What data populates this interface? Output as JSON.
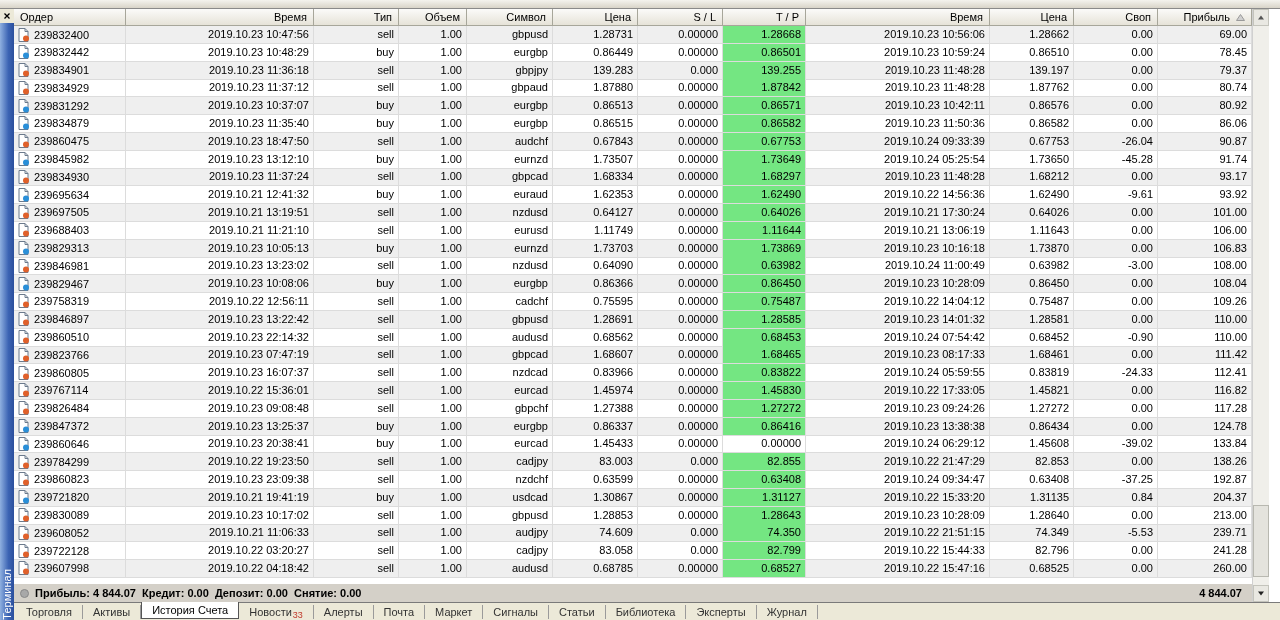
{
  "sidebar": {
    "title": "Терминал"
  },
  "columns": [
    {
      "label": "Ордер",
      "sorted": false
    },
    {
      "label": "Время",
      "sorted": false
    },
    {
      "label": "Тип",
      "sorted": false
    },
    {
      "label": "Объем",
      "sorted": false
    },
    {
      "label": "Символ",
      "sorted": false
    },
    {
      "label": "Цена",
      "sorted": false
    },
    {
      "label": "S / L",
      "sorted": false
    },
    {
      "label": "T / P",
      "sorted": false
    },
    {
      "label": "Время",
      "sorted": false
    },
    {
      "label": "Цена",
      "sorted": false
    },
    {
      "label": "Своп",
      "sorted": false
    },
    {
      "label": "Прибыль",
      "sorted": true
    }
  ],
  "rows": [
    {
      "order": "239832400",
      "kind": "sell",
      "time": "2019.10.23 10:47:56",
      "type": "sell",
      "volume": "1.00",
      "symbol": "gbpusd",
      "price": "1.28731",
      "sl": "0.00000",
      "tp": "1.28668",
      "tp_highlighted": true,
      "close_time": "2019.10.23 10:56:06",
      "close_price": "1.28662",
      "swap": "0.00",
      "profit": "69.00"
    },
    {
      "order": "239832442",
      "kind": "buy",
      "time": "2019.10.23 10:48:29",
      "type": "buy",
      "volume": "1.00",
      "symbol": "eurgbp",
      "price": "0.86449",
      "sl": "0.00000",
      "tp": "0.86501",
      "tp_highlighted": true,
      "close_time": "2019.10.23 10:59:24",
      "close_price": "0.86510",
      "swap": "0.00",
      "profit": "78.45"
    },
    {
      "order": "239834901",
      "kind": "sell",
      "time": "2019.10.23 11:36:18",
      "type": "sell",
      "volume": "1.00",
      "symbol": "gbpjpy",
      "price": "139.283",
      "sl": "0.000",
      "tp": "139.255",
      "tp_highlighted": true,
      "close_time": "2019.10.23 11:48:28",
      "close_price": "139.197",
      "swap": "0.00",
      "profit": "79.37"
    },
    {
      "order": "239834929",
      "kind": "sell",
      "time": "2019.10.23 11:37:12",
      "type": "sell",
      "volume": "1.00",
      "symbol": "gbpaud",
      "price": "1.87880",
      "sl": "0.00000",
      "tp": "1.87842",
      "tp_highlighted": true,
      "close_time": "2019.10.23 11:48:28",
      "close_price": "1.87762",
      "swap": "0.00",
      "profit": "80.74"
    },
    {
      "order": "239831292",
      "kind": "buy",
      "time": "2019.10.23 10:37:07",
      "type": "buy",
      "volume": "1.00",
      "symbol": "eurgbp",
      "price": "0.86513",
      "sl": "0.00000",
      "tp": "0.86571",
      "tp_highlighted": true,
      "close_time": "2019.10.23 10:42:11",
      "close_price": "0.86576",
      "swap": "0.00",
      "profit": "80.92"
    },
    {
      "order": "239834879",
      "kind": "buy",
      "time": "2019.10.23 11:35:40",
      "type": "buy",
      "volume": "1.00",
      "symbol": "eurgbp",
      "price": "0.86515",
      "sl": "0.00000",
      "tp": "0.86582",
      "tp_highlighted": true,
      "close_time": "2019.10.23 11:50:36",
      "close_price": "0.86582",
      "swap": "0.00",
      "profit": "86.06"
    },
    {
      "order": "239860475",
      "kind": "sell",
      "time": "2019.10.23 18:47:50",
      "type": "sell",
      "volume": "1.00",
      "symbol": "audchf",
      "price": "0.67843",
      "sl": "0.00000",
      "tp": "0.67753",
      "tp_highlighted": true,
      "close_time": "2019.10.24 09:33:39",
      "close_price": "0.67753",
      "swap": "-26.04",
      "profit": "90.87"
    },
    {
      "order": "239845982",
      "kind": "buy",
      "time": "2019.10.23 13:12:10",
      "type": "buy",
      "volume": "1.00",
      "symbol": "eurnzd",
      "price": "1.73507",
      "sl": "0.00000",
      "tp": "1.73649",
      "tp_highlighted": true,
      "close_time": "2019.10.24 05:25:54",
      "close_price": "1.73650",
      "swap": "-45.28",
      "profit": "91.74"
    },
    {
      "order": "239834930",
      "kind": "sell",
      "time": "2019.10.23 11:37:24",
      "type": "sell",
      "volume": "1.00",
      "symbol": "gbpcad",
      "price": "1.68334",
      "sl": "0.00000",
      "tp": "1.68297",
      "tp_highlighted": true,
      "close_time": "2019.10.23 11:48:28",
      "close_price": "1.68212",
      "swap": "0.00",
      "profit": "93.17"
    },
    {
      "order": "239695634",
      "kind": "buy",
      "time": "2019.10.21 12:41:32",
      "type": "buy",
      "volume": "1.00",
      "symbol": "euraud",
      "price": "1.62353",
      "sl": "0.00000",
      "tp": "1.62490",
      "tp_highlighted": true,
      "close_time": "2019.10.22 14:56:36",
      "close_price": "1.62490",
      "swap": "-9.61",
      "profit": "93.92"
    },
    {
      "order": "239697505",
      "kind": "sell",
      "time": "2019.10.21 13:19:51",
      "type": "sell",
      "volume": "1.00",
      "symbol": "nzdusd",
      "price": "0.64127",
      "sl": "0.00000",
      "tp": "0.64026",
      "tp_highlighted": true,
      "close_time": "2019.10.21 17:30:24",
      "close_price": "0.64026",
      "swap": "0.00",
      "profit": "101.00"
    },
    {
      "order": "239688403",
      "kind": "sell",
      "time": "2019.10.21 11:21:10",
      "type": "sell",
      "volume": "1.00",
      "symbol": "eurusd",
      "price": "1.11749",
      "sl": "0.00000",
      "tp": "1.11644",
      "tp_highlighted": true,
      "close_time": "2019.10.21 13:06:19",
      "close_price": "1.11643",
      "swap": "0.00",
      "profit": "106.00"
    },
    {
      "order": "239829313",
      "kind": "buy",
      "time": "2019.10.23 10:05:13",
      "type": "buy",
      "volume": "1.00",
      "symbol": "eurnzd",
      "price": "1.73703",
      "sl": "0.00000",
      "tp": "1.73869",
      "tp_highlighted": true,
      "close_time": "2019.10.23 10:16:18",
      "close_price": "1.73870",
      "swap": "0.00",
      "profit": "106.83"
    },
    {
      "order": "239846981",
      "kind": "sell",
      "time": "2019.10.23 13:23:02",
      "type": "sell",
      "volume": "1.00",
      "symbol": "nzdusd",
      "price": "0.64090",
      "sl": "0.00000",
      "tp": "0.63982",
      "tp_highlighted": true,
      "close_time": "2019.10.24 11:00:49",
      "close_price": "0.63982",
      "swap": "-3.00",
      "profit": "108.00"
    },
    {
      "order": "239829467",
      "kind": "buy",
      "time": "2019.10.23 10:08:06",
      "type": "buy",
      "volume": "1.00",
      "symbol": "eurgbp",
      "price": "0.86366",
      "sl": "0.00000",
      "tp": "0.86450",
      "tp_highlighted": true,
      "close_time": "2019.10.23 10:28:09",
      "close_price": "0.86450",
      "swap": "0.00",
      "profit": "108.04"
    },
    {
      "order": "239758319",
      "kind": "sell",
      "time": "2019.10.22 12:56:11",
      "type": "sell",
      "volume": "1.00",
      "symbol": "cadchf",
      "price": "0.75595",
      "sl": "0.00000",
      "tp": "0.75487",
      "tp_highlighted": true,
      "close_time": "2019.10.22 14:04:12",
      "close_price": "0.75487",
      "swap": "0.00",
      "profit": "109.26"
    },
    {
      "order": "239846897",
      "kind": "sell",
      "time": "2019.10.23 13:22:42",
      "type": "sell",
      "volume": "1.00",
      "symbol": "gbpusd",
      "price": "1.28691",
      "sl": "0.00000",
      "tp": "1.28585",
      "tp_highlighted": true,
      "close_time": "2019.10.23 14:01:32",
      "close_price": "1.28581",
      "swap": "0.00",
      "profit": "110.00"
    },
    {
      "order": "239860510",
      "kind": "sell",
      "time": "2019.10.23 22:14:32",
      "type": "sell",
      "volume": "1.00",
      "symbol": "audusd",
      "price": "0.68562",
      "sl": "0.00000",
      "tp": "0.68453",
      "tp_highlighted": true,
      "close_time": "2019.10.24 07:54:42",
      "close_price": "0.68452",
      "swap": "-0.90",
      "profit": "110.00"
    },
    {
      "order": "239823766",
      "kind": "sell",
      "time": "2019.10.23 07:47:19",
      "type": "sell",
      "volume": "1.00",
      "symbol": "gbpcad",
      "price": "1.68607",
      "sl": "0.00000",
      "tp": "1.68465",
      "tp_highlighted": true,
      "close_time": "2019.10.23 08:17:33",
      "close_price": "1.68461",
      "swap": "0.00",
      "profit": "111.42"
    },
    {
      "order": "239860805",
      "kind": "sell",
      "time": "2019.10.23 16:07:37",
      "type": "sell",
      "volume": "1.00",
      "symbol": "nzdcad",
      "price": "0.83966",
      "sl": "0.00000",
      "tp": "0.83822",
      "tp_highlighted": true,
      "close_time": "2019.10.24 05:59:55",
      "close_price": "0.83819",
      "swap": "-24.33",
      "profit": "112.41"
    },
    {
      "order": "239767114",
      "kind": "sell",
      "time": "2019.10.22 15:36:01",
      "type": "sell",
      "volume": "1.00",
      "symbol": "eurcad",
      "price": "1.45974",
      "sl": "0.00000",
      "tp": "1.45830",
      "tp_highlighted": true,
      "close_time": "2019.10.22 17:33:05",
      "close_price": "1.45821",
      "swap": "0.00",
      "profit": "116.82"
    },
    {
      "order": "239826484",
      "kind": "sell",
      "time": "2019.10.23 09:08:48",
      "type": "sell",
      "volume": "1.00",
      "symbol": "gbpchf",
      "price": "1.27388",
      "sl": "0.00000",
      "tp": "1.27272",
      "tp_highlighted": true,
      "close_time": "2019.10.23 09:24:26",
      "close_price": "1.27272",
      "swap": "0.00",
      "profit": "117.28"
    },
    {
      "order": "239847372",
      "kind": "buy",
      "time": "2019.10.23 13:25:37",
      "type": "buy",
      "volume": "1.00",
      "symbol": "eurgbp",
      "price": "0.86337",
      "sl": "0.00000",
      "tp": "0.86416",
      "tp_highlighted": true,
      "close_time": "2019.10.23 13:38:38",
      "close_price": "0.86434",
      "swap": "0.00",
      "profit": "124.78"
    },
    {
      "order": "239860646",
      "kind": "buy",
      "time": "2019.10.23 20:38:41",
      "type": "buy",
      "volume": "1.00",
      "symbol": "eurcad",
      "price": "1.45433",
      "sl": "0.00000",
      "tp": "0.00000",
      "tp_highlighted": false,
      "close_time": "2019.10.24 06:29:12",
      "close_price": "1.45608",
      "swap": "-39.02",
      "profit": "133.84"
    },
    {
      "order": "239784299",
      "kind": "sell",
      "time": "2019.10.22 19:23:50",
      "type": "sell",
      "volume": "1.00",
      "symbol": "cadjpy",
      "price": "83.003",
      "sl": "0.000",
      "tp": "82.855",
      "tp_highlighted": true,
      "close_time": "2019.10.22 21:47:29",
      "close_price": "82.853",
      "swap": "0.00",
      "profit": "138.26"
    },
    {
      "order": "239860823",
      "kind": "sell",
      "time": "2019.10.23 23:09:38",
      "type": "sell",
      "volume": "1.00",
      "symbol": "nzdchf",
      "price": "0.63599",
      "sl": "0.00000",
      "tp": "0.63408",
      "tp_highlighted": true,
      "close_time": "2019.10.24 09:34:47",
      "close_price": "0.63408",
      "swap": "-37.25",
      "profit": "192.87"
    },
    {
      "order": "239721820",
      "kind": "buy",
      "time": "2019.10.21 19:41:19",
      "type": "buy",
      "volume": "1.00",
      "symbol": "usdcad",
      "price": "1.30867",
      "sl": "0.00000",
      "tp": "1.31127",
      "tp_highlighted": true,
      "close_time": "2019.10.22 15:33:20",
      "close_price": "1.31135",
      "swap": "0.84",
      "profit": "204.37"
    },
    {
      "order": "239830089",
      "kind": "sell",
      "time": "2019.10.23 10:17:02",
      "type": "sell",
      "volume": "1.00",
      "symbol": "gbpusd",
      "price": "1.28853",
      "sl": "0.00000",
      "tp": "1.28643",
      "tp_highlighted": true,
      "close_time": "2019.10.23 10:28:09",
      "close_price": "1.28640",
      "swap": "0.00",
      "profit": "213.00"
    },
    {
      "order": "239608052",
      "kind": "sell",
      "time": "2019.10.21 11:06:33",
      "type": "sell",
      "volume": "1.00",
      "symbol": "audjpy",
      "price": "74.609",
      "sl": "0.000",
      "tp": "74.350",
      "tp_highlighted": true,
      "close_time": "2019.10.22 21:51:15",
      "close_price": "74.349",
      "swap": "-5.53",
      "profit": "239.71"
    },
    {
      "order": "239722128",
      "kind": "sell",
      "time": "2019.10.22 03:20:27",
      "type": "sell",
      "volume": "1.00",
      "symbol": "cadjpy",
      "price": "83.058",
      "sl": "0.000",
      "tp": "82.799",
      "tp_highlighted": true,
      "close_time": "2019.10.22 15:44:33",
      "close_price": "82.796",
      "swap": "0.00",
      "profit": "241.28"
    },
    {
      "order": "239607998",
      "kind": "sell",
      "time": "2019.10.22 04:18:42",
      "type": "sell",
      "volume": "1.00",
      "symbol": "audusd",
      "price": "0.68785",
      "sl": "0.00000",
      "tp": "0.68527",
      "tp_highlighted": true,
      "close_time": "2019.10.22 15:47:16",
      "close_price": "0.68525",
      "swap": "0.00",
      "profit": "260.00"
    }
  ],
  "summary": {
    "text": "Прибыль: 4 844.07  Кредит: 0.00  Депозит: 0.00  Снятие: 0.00",
    "total": "4 844.07"
  },
  "tabs": [
    {
      "label": "Торговля",
      "selected": false
    },
    {
      "label": "Активы",
      "selected": false
    },
    {
      "label": "История Счета",
      "selected": true
    },
    {
      "label": "Новости",
      "selected": false,
      "badge": "33"
    },
    {
      "label": "Алерты",
      "selected": false
    },
    {
      "label": "Почта",
      "selected": false
    },
    {
      "label": "Маркет",
      "selected": false
    },
    {
      "label": "Сигналы",
      "selected": false
    },
    {
      "label": "Статьи",
      "selected": false
    },
    {
      "label": "Библиотека",
      "selected": false
    },
    {
      "label": "Эксперты",
      "selected": false
    },
    {
      "label": "Журнал",
      "selected": false
    }
  ]
}
